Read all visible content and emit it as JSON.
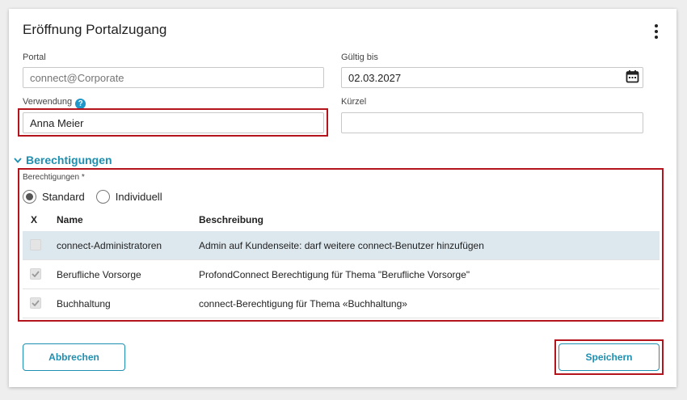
{
  "dialog": {
    "title": "Eröffnung Portalzugang"
  },
  "form": {
    "portal_label": "Portal",
    "portal_placeholder": "connect@Corporate",
    "valid_until_label": "Gültig bis",
    "valid_until_value": "02.03.2027",
    "usage_label": "Verwendung",
    "usage_value": "Anna Meier",
    "short_label": "Kürzel",
    "short_value": ""
  },
  "permissions": {
    "section_title": "Berechtigungen",
    "field_label": "Berechtigungen *",
    "radio_standard": "Standard",
    "radio_individual": "Individuell",
    "selected_mode": "Standard",
    "columns": [
      "X",
      "Name",
      "Beschreibung"
    ],
    "rows": [
      {
        "checked": false,
        "name": "connect-Administratoren",
        "description": "Admin auf Kundenseite: darf weitere connect-Benutzer hinzufügen"
      },
      {
        "checked": true,
        "name": "Berufliche Vorsorge",
        "description": "ProfondConnect Berechtigung für Thema \"Berufliche Vorsorge\""
      },
      {
        "checked": true,
        "name": "Buchhaltung",
        "description": "connect-Berechtigung für Thema «Buchhaltung»"
      }
    ]
  },
  "actions": {
    "cancel_label": "Abbrechen",
    "save_label": "Speichern"
  },
  "colors": {
    "accent": "#1f8fb0",
    "highlight": "#b4151c",
    "selected_row": "#dde7ee"
  }
}
